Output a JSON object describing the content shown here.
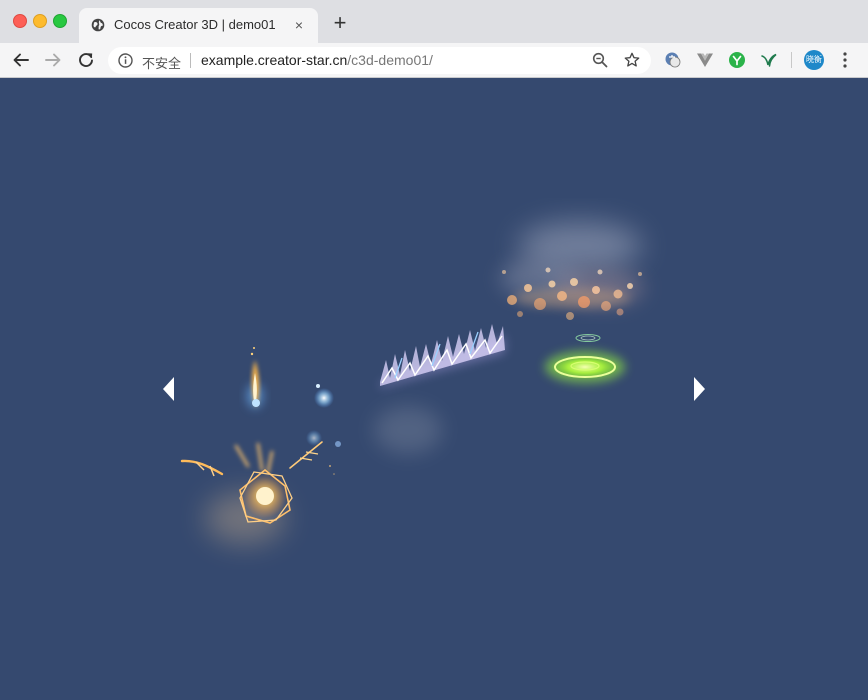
{
  "browser": {
    "tab": {
      "title": "Cocos Creator 3D | demo01",
      "close_glyph": "×",
      "favicon": "globe-icon"
    },
    "new_tab_glyph": "+",
    "security_label": "不安全",
    "url": {
      "host": "example.creator-star.cn",
      "path": "/c3d-demo01/"
    },
    "profile_label": "晓衡",
    "colors": {
      "tabstrip": "#dedfe3",
      "toolbar": "#f5f5f6",
      "avatar": "#1e88c9"
    }
  },
  "scene": {
    "background": "#35496f",
    "prev_arrow": "arrow-left-icon",
    "next_arrow": "arrow-right-icon",
    "effects": [
      "magic-circle-effect",
      "flame-effect",
      "lightning-wall-effect",
      "smoke-burst-effect",
      "green-ring-effect"
    ]
  }
}
